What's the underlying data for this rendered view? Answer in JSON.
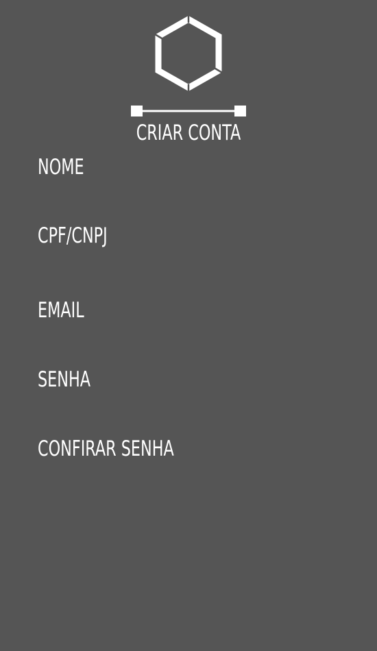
{
  "header": {
    "logo_icon": "hexagon-icon",
    "title": "CRIAR CONTA"
  },
  "form": {
    "fields": [
      {
        "label": "NOME"
      },
      {
        "label": "CPF/CNPJ"
      },
      {
        "label": "EMAIL"
      },
      {
        "label": "SENHA"
      },
      {
        "label": "CONFIRAR SENHA"
      }
    ]
  },
  "colors": {
    "background": "#555555",
    "foreground": "#ffffff"
  }
}
